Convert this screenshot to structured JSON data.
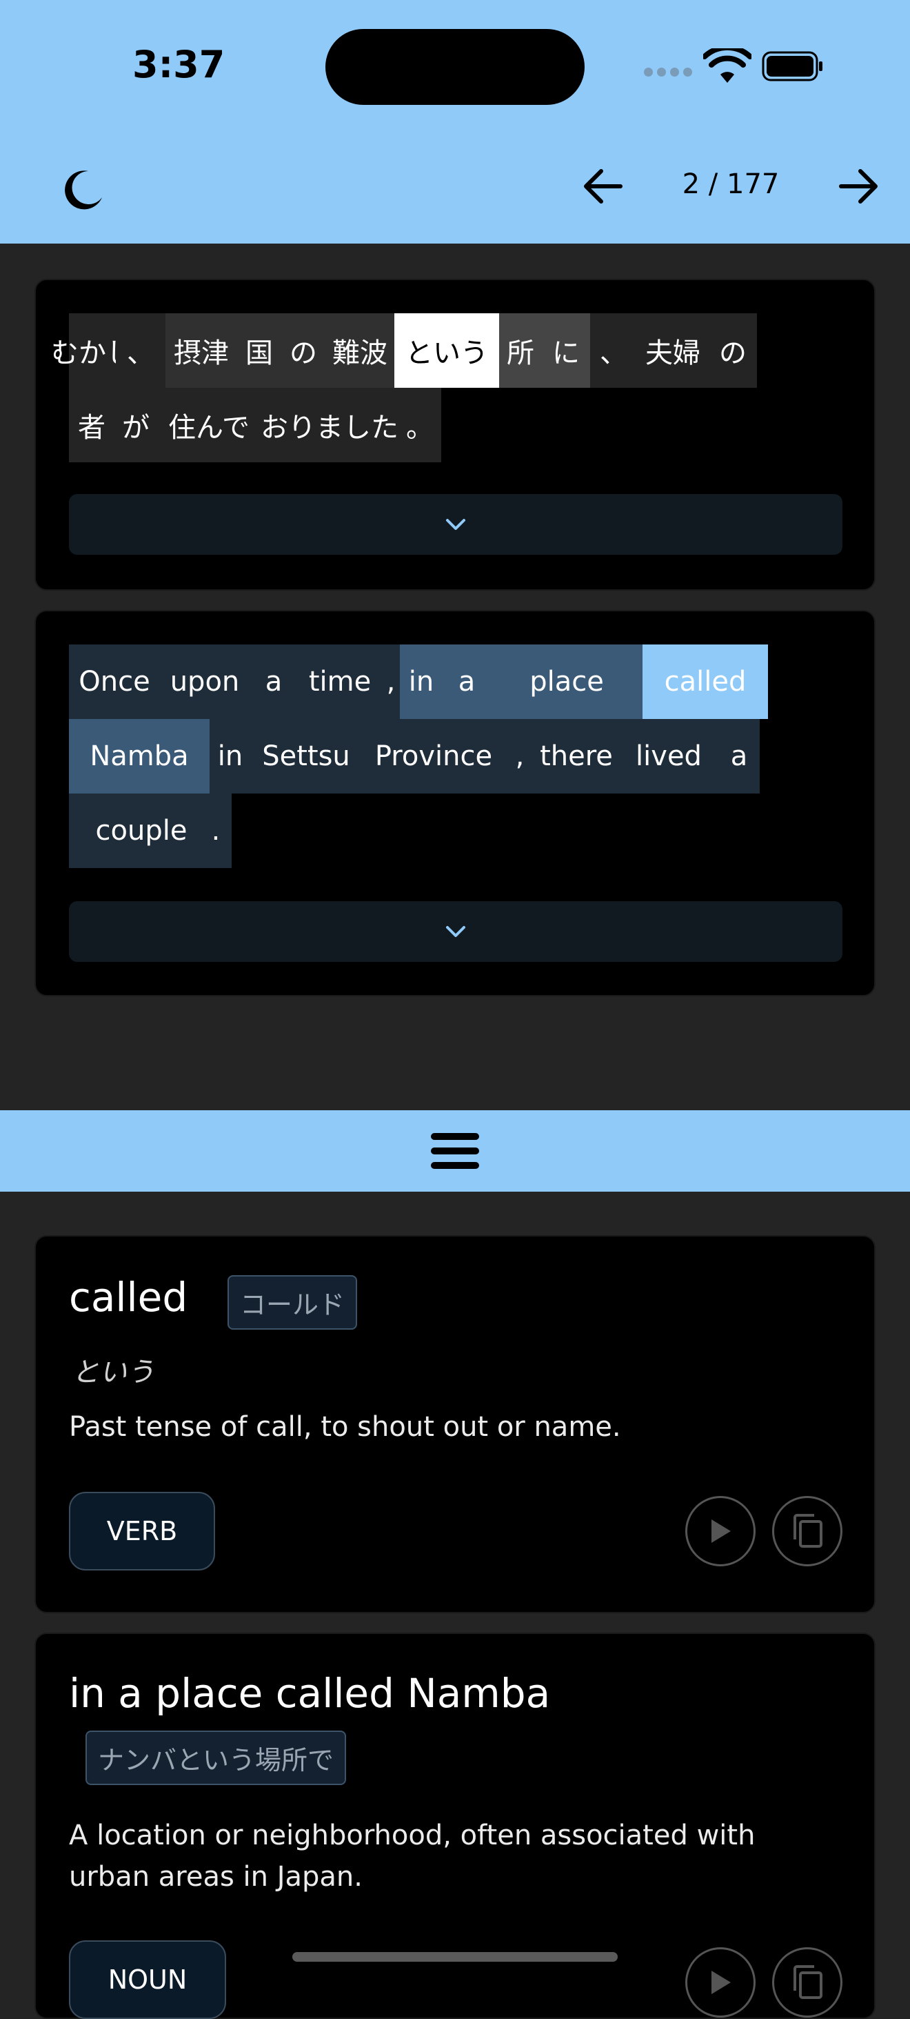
{
  "status_bar": {
    "time": "3:37"
  },
  "nav": {
    "page_counter": "2 / 177"
  },
  "source_sentence": {
    "lines": [
      [
        "むかし",
        "、",
        "摂津",
        "国",
        "の",
        "難波",
        "という",
        "所",
        "に",
        "、",
        "夫婦",
        "の"
      ],
      [
        "者",
        "が",
        "住んで",
        "おりました",
        "。"
      ]
    ]
  },
  "translation_sentence": {
    "lines": [
      [
        "Once",
        "upon",
        "a",
        "time",
        ",",
        "in",
        "a",
        "place",
        "called"
      ],
      [
        "Namba",
        "in",
        "Settsu",
        "Province",
        ",",
        "there",
        "lived",
        "a"
      ],
      [
        "couple",
        "."
      ]
    ]
  },
  "details": [
    {
      "word": "called",
      "katakana": "コールド",
      "reading": "という",
      "definition": "Past tense of call, to shout out or name.",
      "pos": "VERB"
    },
    {
      "word": "in a place called Namba",
      "katakana": "ナンバという場所で",
      "definition": "A location or neighborhood, often associated with urban areas in Japan.",
      "pos": "NOUN"
    }
  ],
  "icons": {
    "theme": "moon-icon",
    "prev": "arrow-left-icon",
    "next": "arrow-right-icon",
    "expand": "chevron-down-icon",
    "handle": "menu-icon",
    "play": "play-icon",
    "copy": "copy-icon"
  },
  "colors": {
    "accent": "#90CAF9",
    "background": "#242424",
    "card": "#000000",
    "highlight_selected": "#FFFFFF",
    "translation_selected": "#90CAF9"
  }
}
